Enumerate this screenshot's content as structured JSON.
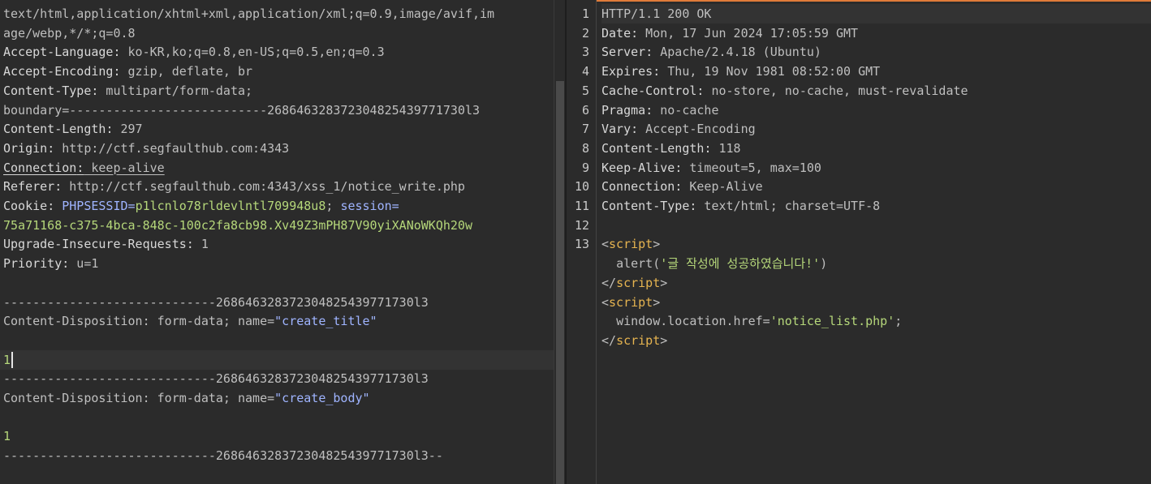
{
  "request": {
    "lines": [
      {
        "v": "text/html,application/xhtml+xml,application/xml;q=0.9,image/avif,im"
      },
      {
        "v": "age/webp,*/*;q=0.8"
      },
      {
        "k": "Accept-Language",
        "v": " ko-KR,ko;q=0.8,en-US;q=0.5,en;q=0.3"
      },
      {
        "k": "Accept-Encoding",
        "v": " gzip, deflate, br"
      },
      {
        "k": "Content-Type",
        "v": " multipart/form-data;"
      },
      {
        "v": "boundary=---------------------------268646328372304825439771730l3"
      },
      {
        "k": "Content-Length",
        "v": " 297"
      },
      {
        "k": "Origin",
        "v": " http://ctf.segfaulthub.com:4343"
      },
      {
        "k": "Connection",
        "v": " keep-alive"
      },
      {
        "k": "Referer",
        "v": " http://ctf.segfaulthub.com:4343/xss_1/notice_write.php"
      },
      {
        "k": "Cookie",
        "v": " ",
        "c1k": "PHPSESSID",
        "c1v": "p1lcnlo78rldevlntl709948u8",
        "c2k": "session"
      },
      {
        "g": "75a71168-c375-4bca-848c-100c2fa8cb98.Xv49Z3mPH87V90yiXANoWKQh20w"
      },
      {
        "k": "Upgrade-Insecure-Requests",
        "v": " 1"
      },
      {
        "k": "Priority",
        "v": " u=1"
      },
      {
        "v": ""
      },
      {
        "v": "-----------------------------268646328372304825439771730l3"
      },
      {
        "v": "Content-Disposition: form-data; name=",
        "q": "\"create_title\""
      },
      {
        "v": ""
      },
      {
        "g": "1",
        "caret": true
      },
      {
        "v": "-----------------------------268646328372304825439771730l3"
      },
      {
        "v": "Content-Disposition: form-data; name=",
        "q": "\"create_body\""
      },
      {
        "v": ""
      },
      {
        "g": "1"
      },
      {
        "v": "-----------------------------268646328372304825439771730l3--"
      }
    ]
  },
  "response": {
    "lines": [
      {
        "n": "1",
        "v": "HTTP/1.1 200 OK"
      },
      {
        "n": "2",
        "k": "Date",
        "v": " Mon, 17 Jun 2024 17:05:59 GMT"
      },
      {
        "n": "3",
        "k": "Server",
        "v": " Apache/2.4.18 (Ubuntu)"
      },
      {
        "n": "4",
        "k": "Expires",
        "v": " Thu, 19 Nov 1981 08:52:00 GMT"
      },
      {
        "n": "5",
        "k": "Cache-Control",
        "v": " no-store, no-cache, must-revalidate"
      },
      {
        "n": "6",
        "k": "Pragma",
        "v": " no-cache"
      },
      {
        "n": "7",
        "k": "Vary",
        "v": " Accept-Encoding"
      },
      {
        "n": "8",
        "k": "Content-Length",
        "v": " 118"
      },
      {
        "n": "9",
        "k": "Keep-Alive",
        "v": " timeout=5, max=100"
      },
      {
        "n": "10",
        "k": "Connection",
        "v": " Keep-Alive"
      },
      {
        "n": "11",
        "k": "Content-Type",
        "v": " text/html; charset=UTF-8"
      },
      {
        "n": "12",
        "v": ""
      },
      {
        "n": "13",
        "tag": "script"
      },
      {
        "n": "",
        "ind": "  ",
        "v": "alert(",
        "g": "'글 작성에 성공하였습니다!'",
        "v2": ")"
      },
      {
        "n": "",
        "closetag": "script"
      },
      {
        "n": "",
        "tag": "script"
      },
      {
        "n": "",
        "ind": "  ",
        "v": "window.location.href=",
        "g": "'notice_list.php'",
        "v2": ";"
      },
      {
        "n": "",
        "closetag": "script"
      }
    ]
  },
  "colors": {
    "accent": "#e07b39",
    "string": "#b5d77a",
    "attr": "#9fb4ff",
    "tag": "#e6b450"
  }
}
